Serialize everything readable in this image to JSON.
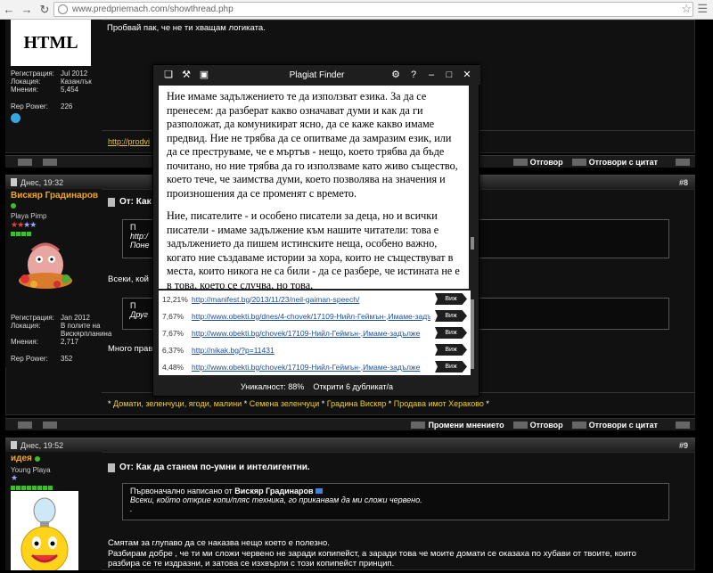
{
  "browser": {
    "url": "www.predpriemach.com/showthread.php"
  },
  "post_prev": {
    "badge": "HTML",
    "stats": [
      {
        "k": "Регистрация:",
        "v": "Jul 2012"
      },
      {
        "k": "Локация:",
        "v": "Казанлък"
      },
      {
        "k": "Мнения:",
        "v": "5,454"
      }
    ],
    "rep_label": "Rep Power:",
    "rep_value": "226",
    "text": "Пробвай пак, че не ти хващам логиката.",
    "link": "http://prodvi"
  },
  "footer_buttons": {
    "reply": "Отговор",
    "reply_quote": "Отговори с цитат",
    "edit": "Промени мнението"
  },
  "post8": {
    "date": "Днес, 19:32",
    "number": "#8",
    "username": "Вискяр Градинаров",
    "user_title": "Playa Pimp",
    "stats": [
      {
        "k": "Регистрация:",
        "v": "Jan 2012"
      },
      {
        "k": "Локация:",
        "v": "В полите на Вискярпланина"
      },
      {
        "k": "Мнения:",
        "v": "2,717"
      }
    ],
    "rep_label": "Rep Power:",
    "rep_value": "352",
    "title": "От: Как",
    "quote1_head": "П",
    "quote1_line1": "http:/",
    "quote1_line2": "Поне",
    "text1": "Всеки, кой",
    "quote2_head": "П",
    "quote2_text": "Друг",
    "text2": "Много прав",
    "signature": [
      "Домати, зеленчуци, ягоди, малини",
      "Семена зеленчуци",
      "Градина Вискяр",
      "Продава имот Хераково"
    ]
  },
  "post9": {
    "date": "Днес, 19:52",
    "number": "#9",
    "username": "идея",
    "user_title": "Young Playa",
    "title": "От: Как да станем по-умни и интелигентни.",
    "quote_head_prefix": "Първоначално написано от",
    "quote_author": "Вискяр Градинаров",
    "quote_text": "Всеки, който открие копи/пляс техника, го приканвам да ми сложи червено.",
    "quote_dot": ".",
    "text_line1": "Смятам за глупаво да се наказва нещо което е полезно.",
    "text_line2": "Разбирам добре , че ти ми сложи червено не заради копипейст, а заради това че моите домати се оказаха по хубави от твоите, които",
    "text_line3": "разбира се те издразни, и затова се изхвърли с този копипейст принцип."
  },
  "plagiat": {
    "title": "Plagiat Finder",
    "paragraph1": "Ние имаме задължението те да използват езика. За да се пренесем: да разберат какво означават думи и как да ги разположат, да комуникират ясно, да се каже какво имаме предвид. Ние не трябва да се опитваме да замразим език, или да се преструваме, че е мъртъв - нещо, което трябва да бъде почитано, но ние трябва да го използваме като живо същество, което тече, че заимства думи, което позволява на значения и произношения да се променят с времето.",
    "paragraph2": "Ние, писателите - и особено писатели за деца, но и всички писатели - имаме задължение към нашите читатели: това е задължението да пишем истинските неща, особено важно, когато ние създаваме истории за хора, които не съществуват в места, които никога не са били - да се разбере, че истината не е в това, което се случва, но това,",
    "results": [
      {
        "pct": "12,21%",
        "url": "http://manifest.bg/2013/11/23/neil-gaiman-speech/",
        "btn": "Виж"
      },
      {
        "pct": "7,67%",
        "url": "http://www.obekti.bg/dnes/4-chovek/17109-Нийл-Геймън-,Имаме-задълж",
        "btn": "Виж"
      },
      {
        "pct": "7,67%",
        "url": "http://www.obekti.bg/chovek/17109-Нийл-Геймън-,Имаме-задълже",
        "btn": "Виж"
      },
      {
        "pct": "6,37%",
        "url": "http://nikak.bg/?p=11431",
        "btn": "Виж"
      },
      {
        "pct": "4,48%",
        "url": "http://www.obekti.bg/chovek/17109-Нийл-Геймън-,Имаме-задълже",
        "btn": "Виж"
      }
    ],
    "uniqueness": "Уникалност: 88%",
    "duplicates": "Открити 6 дубликат/а"
  }
}
